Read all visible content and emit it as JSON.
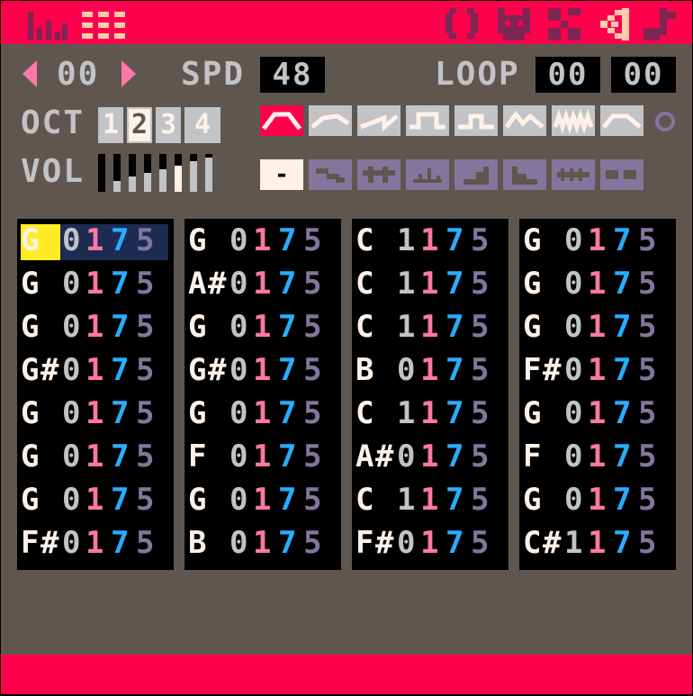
{
  "topbar": {
    "tabs": [
      {
        "name": "sfx-editor-icon"
      },
      {
        "name": "pattern-list-icon"
      }
    ],
    "tools": [
      {
        "name": "code-editor-icon"
      },
      {
        "name": "sprite-editor-icon"
      },
      {
        "name": "map-editor-icon"
      },
      {
        "name": "sfx-tab-icon"
      },
      {
        "name": "music-editor-icon"
      }
    ]
  },
  "sfx": {
    "index": "00",
    "speed_label": "SPD",
    "speed": "48",
    "loop_label": "LOOP",
    "loop_start": "00",
    "loop_end": "00"
  },
  "octave": {
    "label": "OCT",
    "options": [
      "1",
      "2",
      "3",
      "4"
    ],
    "selected": "2"
  },
  "volume": {
    "label": "VOL",
    "levels": 8,
    "selected_level": 5
  },
  "instruments": [
    {
      "name": "triangle-wave-icon",
      "selected": true
    },
    {
      "name": "tilted-saw-wave-icon"
    },
    {
      "name": "saw-wave-icon"
    },
    {
      "name": "square-wave-icon"
    },
    {
      "name": "pulse-wave-icon"
    },
    {
      "name": "organ-wave-icon"
    },
    {
      "name": "noise-wave-icon"
    },
    {
      "name": "phaser-wave-icon"
    }
  ],
  "custom_toggle": {
    "name": "custom-instrument-toggle-icon"
  },
  "effects": [
    {
      "name": "none-effect-icon",
      "label": "-",
      "selected": true
    },
    {
      "name": "slide-effect-icon"
    },
    {
      "name": "vibrato-effect-icon"
    },
    {
      "name": "drop-effect-icon"
    },
    {
      "name": "fade-in-effect-icon"
    },
    {
      "name": "fade-out-effect-icon"
    },
    {
      "name": "arpeggio-fast-effect-icon"
    },
    {
      "name": "arpeggio-slow-effect-icon"
    }
  ],
  "tracker": {
    "cursor": {
      "column": 0,
      "row": 0
    },
    "columns": [
      [
        {
          "note": "G",
          "sharp": "",
          "octave": "0",
          "instrument": "1",
          "volume": "7",
          "effect": "5"
        },
        {
          "note": "G",
          "sharp": "",
          "octave": "0",
          "instrument": "1",
          "volume": "7",
          "effect": "5"
        },
        {
          "note": "G",
          "sharp": "",
          "octave": "0",
          "instrument": "1",
          "volume": "7",
          "effect": "5"
        },
        {
          "note": "G",
          "sharp": "#",
          "octave": "0",
          "instrument": "1",
          "volume": "7",
          "effect": "5"
        },
        {
          "note": "G",
          "sharp": "",
          "octave": "0",
          "instrument": "1",
          "volume": "7",
          "effect": "5"
        },
        {
          "note": "G",
          "sharp": "",
          "octave": "0",
          "instrument": "1",
          "volume": "7",
          "effect": "5"
        },
        {
          "note": "G",
          "sharp": "",
          "octave": "0",
          "instrument": "1",
          "volume": "7",
          "effect": "5"
        },
        {
          "note": "F",
          "sharp": "#",
          "octave": "0",
          "instrument": "1",
          "volume": "7",
          "effect": "5"
        }
      ],
      [
        {
          "note": "G",
          "sharp": "",
          "octave": "0",
          "instrument": "1",
          "volume": "7",
          "effect": "5"
        },
        {
          "note": "A",
          "sharp": "#",
          "octave": "0",
          "instrument": "1",
          "volume": "7",
          "effect": "5"
        },
        {
          "note": "G",
          "sharp": "",
          "octave": "0",
          "instrument": "1",
          "volume": "7",
          "effect": "5"
        },
        {
          "note": "G",
          "sharp": "#",
          "octave": "0",
          "instrument": "1",
          "volume": "7",
          "effect": "5"
        },
        {
          "note": "G",
          "sharp": "",
          "octave": "0",
          "instrument": "1",
          "volume": "7",
          "effect": "5"
        },
        {
          "note": "F",
          "sharp": "",
          "octave": "0",
          "instrument": "1",
          "volume": "7",
          "effect": "5"
        },
        {
          "note": "G",
          "sharp": "",
          "octave": "0",
          "instrument": "1",
          "volume": "7",
          "effect": "5"
        },
        {
          "note": "B",
          "sharp": "",
          "octave": "0",
          "instrument": "1",
          "volume": "7",
          "effect": "5"
        }
      ],
      [
        {
          "note": "C",
          "sharp": "",
          "octave": "1",
          "instrument": "1",
          "volume": "7",
          "effect": "5"
        },
        {
          "note": "C",
          "sharp": "",
          "octave": "1",
          "instrument": "1",
          "volume": "7",
          "effect": "5"
        },
        {
          "note": "C",
          "sharp": "",
          "octave": "1",
          "instrument": "1",
          "volume": "7",
          "effect": "5"
        },
        {
          "note": "B",
          "sharp": "",
          "octave": "0",
          "instrument": "1",
          "volume": "7",
          "effect": "5"
        },
        {
          "note": "C",
          "sharp": "",
          "octave": "1",
          "instrument": "1",
          "volume": "7",
          "effect": "5"
        },
        {
          "note": "A",
          "sharp": "#",
          "octave": "0",
          "instrument": "1",
          "volume": "7",
          "effect": "5"
        },
        {
          "note": "C",
          "sharp": "",
          "octave": "1",
          "instrument": "1",
          "volume": "7",
          "effect": "5"
        },
        {
          "note": "F",
          "sharp": "#",
          "octave": "0",
          "instrument": "1",
          "volume": "7",
          "effect": "5"
        }
      ],
      [
        {
          "note": "G",
          "sharp": "",
          "octave": "0",
          "instrument": "1",
          "volume": "7",
          "effect": "5"
        },
        {
          "note": "G",
          "sharp": "",
          "octave": "0",
          "instrument": "1",
          "volume": "7",
          "effect": "5"
        },
        {
          "note": "G",
          "sharp": "",
          "octave": "0",
          "instrument": "1",
          "volume": "7",
          "effect": "5"
        },
        {
          "note": "F",
          "sharp": "#",
          "octave": "0",
          "instrument": "1",
          "volume": "7",
          "effect": "5"
        },
        {
          "note": "G",
          "sharp": "",
          "octave": "0",
          "instrument": "1",
          "volume": "7",
          "effect": "5"
        },
        {
          "note": "F",
          "sharp": "",
          "octave": "0",
          "instrument": "1",
          "volume": "7",
          "effect": "5"
        },
        {
          "note": "G",
          "sharp": "",
          "octave": "0",
          "instrument": "1",
          "volume": "7",
          "effect": "5"
        },
        {
          "note": "C",
          "sharp": "#",
          "octave": "1",
          "instrument": "1",
          "volume": "7",
          "effect": "5"
        }
      ]
    ]
  },
  "colors": {
    "bar": "#ff004d",
    "background": "#5f574f",
    "panel": "#000000",
    "note": "#fff1e8",
    "octave": "#c2c3c7",
    "instrument": "#ff77a8",
    "volume": "#29adff",
    "effect": "#83769c",
    "cursor": "#ffec27",
    "cursor_row": "#1d2b53",
    "muted_icon": "#7e2553",
    "button_off": "#83769c",
    "button_on": "#fff1e8"
  }
}
